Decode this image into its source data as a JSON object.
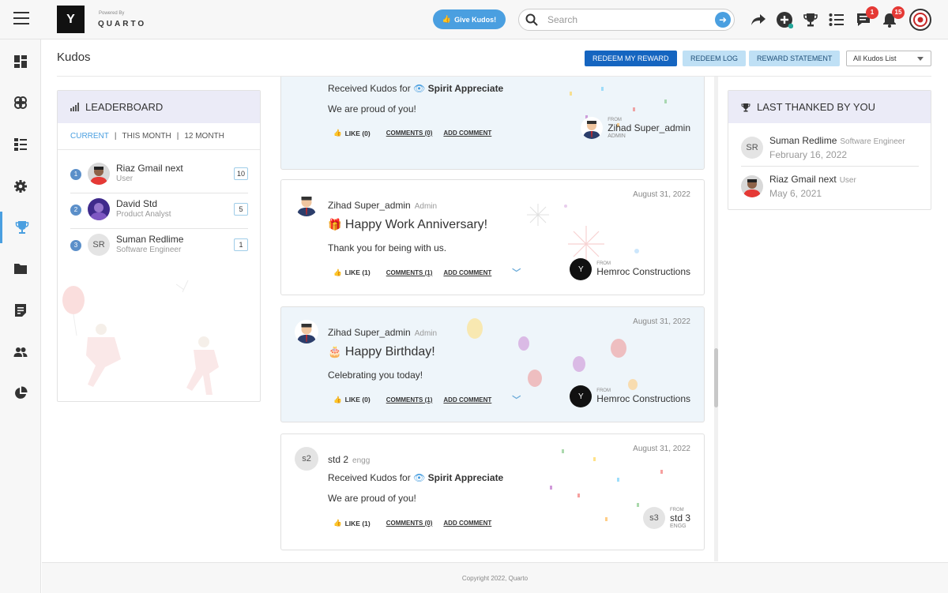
{
  "topbar": {
    "logo_letter": "Y",
    "powered_by": "Powered By",
    "brand": "QUARTO",
    "give_kudos": "Give Kudos!",
    "search_placeholder": "Search",
    "messages_badge": "1",
    "notifications_badge": "15"
  },
  "page": {
    "title": "Kudos",
    "redeem_my_reward": "REDEEM MY REWARD",
    "redeem_log": "REDEEM LOG",
    "reward_statement": "REWARD STATEMENT",
    "filter_selected": "All Kudos List"
  },
  "leaderboard": {
    "title": "LEADERBOARD",
    "tabs": [
      "CURRENT",
      "THIS MONTH",
      "12 MONTH"
    ],
    "sep": "|",
    "rows": [
      {
        "rank": "1",
        "name": "Riaz Gmail next",
        "role": "User",
        "count": "10"
      },
      {
        "rank": "2",
        "name": "David Std",
        "role": "Product Analyst",
        "count": "5"
      },
      {
        "rank": "3",
        "name": "Suman Redlime",
        "role": "Software Engineer",
        "count": "1",
        "initials": "SR"
      }
    ]
  },
  "feed": {
    "posts": [
      {
        "line1_prefix": "Received Kudos for",
        "line1_bold": "Spirit Appreciate",
        "message": "We are proud of you!",
        "like": "LIKE (0)",
        "comments": "COMMENTS (0)",
        "add_comment": "ADD COMMENT",
        "from_label": "FROM",
        "from_name": "Zihad Super_admin",
        "from_role": "ADMIN"
      },
      {
        "author": "Zihad Super_admin",
        "role": "Admin",
        "date": "August 31, 2022",
        "title": "Happy Work Anniversary!",
        "message": "Thank you for being with us.",
        "like": "LIKE (1)",
        "comments": "COMMENTS (1)",
        "add_comment": "ADD COMMENT",
        "from_label": "FROM",
        "from_name": "Hemroc Constructions"
      },
      {
        "author": "Zihad Super_admin",
        "role": "Admin",
        "date": "August 31, 2022",
        "title": "Happy Birthday!",
        "message": "Celebrating you today!",
        "like": "LIKE (0)",
        "comments": "COMMENTS (1)",
        "add_comment": "ADD COMMENT",
        "from_label": "FROM",
        "from_name": "Hemroc Constructions"
      },
      {
        "initials": "s2",
        "author": "std 2",
        "role": "engg",
        "date": "August 31, 2022",
        "line1_prefix": "Received Kudos for",
        "line1_bold": "Spirit Appreciate",
        "message": "We are proud of you!",
        "like": "LIKE (1)",
        "comments": "COMMENTS (0)",
        "add_comment": "ADD COMMENT",
        "from_label": "FROM",
        "from_name": "std 3",
        "from_role": "ENGG",
        "from_initials": "s3"
      }
    ]
  },
  "last_thanked": {
    "title": "LAST THANKED BY YOU",
    "rows": [
      {
        "initials": "SR",
        "name": "Suman Redlime",
        "role": "Software Engineer",
        "date": "February 16, 2022"
      },
      {
        "name": "Riaz Gmail next",
        "role": "User",
        "date": "May 6, 2021"
      }
    ]
  },
  "footer": {
    "copyright": "Copyright 2022, Quarto"
  },
  "colors": {
    "accent": "#4a9fe0",
    "primary_button": "#1565c0",
    "badge": "#e53935",
    "panel_head": "#ebebf7",
    "card_tint": "#eef5fa"
  }
}
